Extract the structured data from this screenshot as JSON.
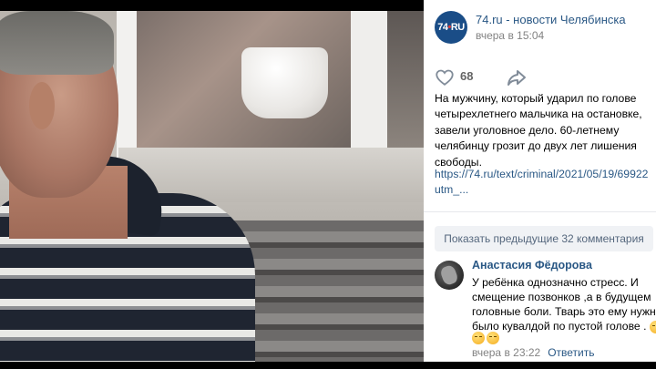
{
  "post": {
    "author": "74.ru - новости Челябинска",
    "avatar_text": "74",
    "avatar_dot": "•",
    "avatar_suffix": "RU",
    "time": "вчера в 15:04",
    "likes": "68",
    "text": "На мужчину, который ударил по голове четырехлетнего мальчика на остановке, завели уголовное дело. 60-летнему челябинцу грозит до двух лет лишения свободы.",
    "link_line1": "https://74.ru/text/criminal/2021/05/19/69922",
    "link_line2": "utm_..."
  },
  "comments": {
    "show_previous": "Показать предыдущие 32 комментария",
    "items": [
      {
        "name": "Анастасия Фёдорова",
        "text": "У ребёнка однозначно стресс. И смещение позвонков ,а в будущем головные боли. Тварь это ему нужно было кувалдой по пустой голове .",
        "time": "вчера в 23:22",
        "reply": "Ответить"
      }
    ]
  },
  "icons": {
    "like": "heart-icon",
    "share": "share-arrow-icon"
  },
  "colors": {
    "link": "#2a5885",
    "muted": "#828282",
    "button_bg": "#f0f2f5",
    "avatar_bg": "#1a4d87"
  }
}
